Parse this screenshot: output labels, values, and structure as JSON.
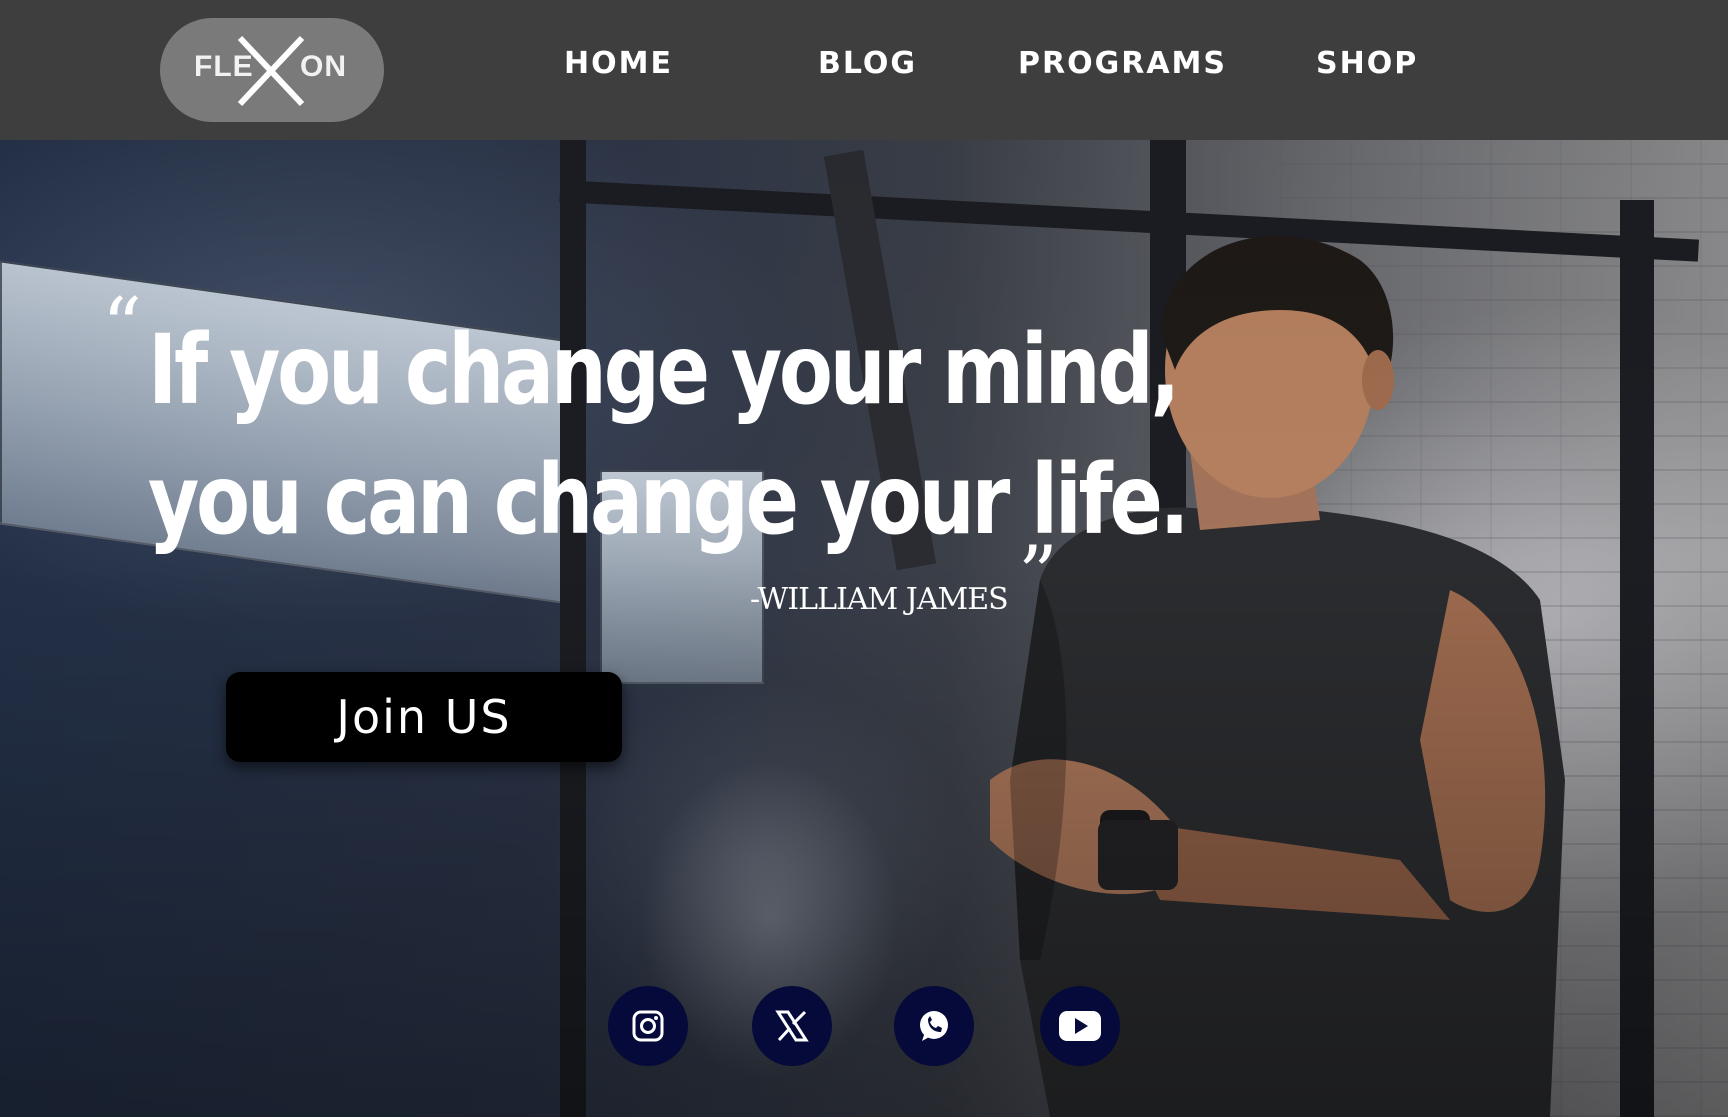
{
  "brand": {
    "logo_left": "FLE",
    "logo_right": "ON",
    "logo_accent_color": "#ffffff",
    "logo_bg_color": "#7a7a7a"
  },
  "nav": {
    "bg_color": "#3e3e3e",
    "items": [
      {
        "label": "HOME"
      },
      {
        "label": "BLOG"
      },
      {
        "label": "PROGRAMS"
      },
      {
        "label": "SHOP"
      }
    ]
  },
  "hero": {
    "quote_open": "“",
    "quote_line1": "If you change your mind,",
    "quote_line2": "you can change your life.",
    "quote_close": "”",
    "author": "-WILLIAM JAMES",
    "cta_label": "Join US"
  },
  "social": {
    "bg_color": "#050a3a",
    "icons": [
      "instagram-icon",
      "x-twitter-icon",
      "whatsapp-icon",
      "youtube-icon"
    ]
  }
}
